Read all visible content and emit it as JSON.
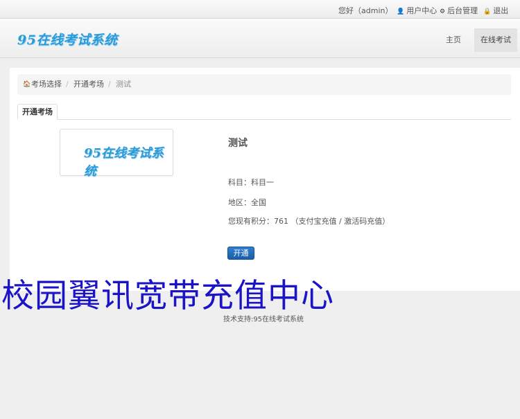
{
  "topbar": {
    "greeting": "您好（admin）",
    "user_center": "用户中心",
    "admin": "后台管理",
    "logout": "退出",
    "icons": {
      "user_center": "user-icon",
      "admin": "gear-icon",
      "logout": "lock-icon"
    }
  },
  "header": {
    "logo": "95在线考试系统",
    "nav": {
      "home": "主页",
      "online_exam": "在线考试"
    }
  },
  "breadcrumb": {
    "items": [
      "考场选择",
      "开通考场"
    ],
    "current": "测试",
    "separator": "/"
  },
  "tabs": {
    "active": "开通考场"
  },
  "exam": {
    "thumb_logo": "95在线考试系统",
    "title": "测试",
    "subject_label": "科目：",
    "subject": "科目一",
    "region_label": "地区：",
    "region": "全国",
    "points_label": "您现有积分：",
    "points": "761",
    "paren_open": "（",
    "alipay_link": "支付宝充值",
    "slash": " / ",
    "code_link": "激活码充值",
    "paren_close": "）",
    "open_button": "开通"
  },
  "overlay_text": "校园翼讯宽带充值中心",
  "footer": "技术支持:95在线考试系统",
  "colors": {
    "logo": "#2b9bd8",
    "button": "#2f7fd0",
    "overlay": "#1a14c6"
  }
}
